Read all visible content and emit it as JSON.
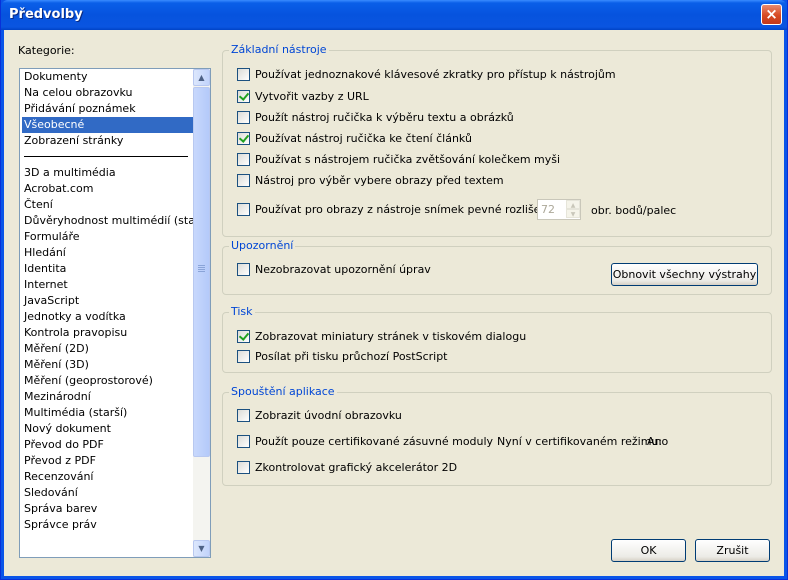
{
  "window": {
    "title": "Předvolby",
    "close": "×"
  },
  "categories": {
    "label": "Kategorie:",
    "top": [
      "Dokumenty",
      "Na celou obrazovku",
      "Přidávání poznámek",
      "Všeobecné",
      "Zobrazení stránky"
    ],
    "selected": "Všeobecné",
    "rest": [
      "3D a multimédia",
      "Acrobat.com",
      "Čtení",
      "Důvěryhodnost multimédií (starší)",
      "Formuláře",
      "Hledání",
      "Identita",
      "Internet",
      "JavaScript",
      "Jednotky a vodítka",
      "Kontrola pravopisu",
      "Měření (2D)",
      "Měření (3D)",
      "Měření (geoprostorové)",
      "Mezinárodní",
      "Multimédia (starší)",
      "Nový dokument",
      "Převod do PDF",
      "Převod z PDF",
      "Recenzování",
      "Sledování",
      "Správa barev",
      "Správce práv"
    ]
  },
  "basic_tools": {
    "title": "Základní nástroje",
    "options": [
      {
        "label": "Používat jednoznakové klávesové zkratky pro přístup k nástrojům",
        "checked": false
      },
      {
        "label": "Vytvořit vazby z URL",
        "checked": true
      },
      {
        "label": "Použít nástroj ručička k výběru textu a obrázků",
        "checked": false
      },
      {
        "label": "Používat nástroj ručička ke čtení článků",
        "checked": true
      },
      {
        "label": "Používat s nástrojem ručička zvětšování kolečkem myši",
        "checked": false
      },
      {
        "label": "Nástroj pro výběr vybere obrazy před textem",
        "checked": false
      },
      {
        "label": "Používat pro obrazy z nástroje snímek pevné rozlišení:",
        "checked": false
      }
    ],
    "resolution_value": "72",
    "resolution_unit": "obr. bodů/palec"
  },
  "warnings": {
    "title": "Upozornění",
    "option": {
      "label": "Nezobrazovat upozornění úprav",
      "checked": false
    },
    "reset_button": "Obnovit všechny výstrahy"
  },
  "print": {
    "title": "Tisk",
    "options": [
      {
        "label": "Zobrazovat miniatury stránek v tiskovém dialogu",
        "checked": true
      },
      {
        "label": "Posílat při tisku průchozí PostScript",
        "checked": false
      }
    ]
  },
  "startup": {
    "title": "Spouštění aplikace",
    "options": [
      {
        "label": "Zobrazit úvodní obrazovku",
        "checked": false
      },
      {
        "label": "Použít pouze certifikované zásuvné moduly",
        "checked": false
      },
      {
        "label": "Zkontrolovat grafický akcelerátor 2D",
        "checked": false
      }
    ],
    "cert_mode_label": "Nyní v certifikovaném režimu:",
    "cert_mode_value": "Ano"
  },
  "footer": {
    "ok": "OK",
    "cancel": "Zrušit"
  }
}
